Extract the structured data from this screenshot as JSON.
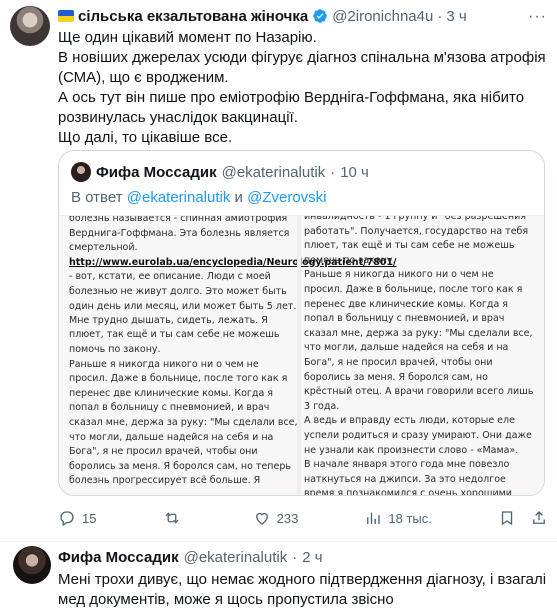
{
  "tweet": {
    "author_name": "сільська екзальтована жіночка",
    "author_handle": "@2ironichna4u",
    "dot": "·",
    "time": "3 ч",
    "more": "···",
    "lines": [
      "Ще один цікавий момент по Назарію.",
      "В новіших джерелах усюди фігурує діагноз спінальна м'язова атрофія (СМА), що є вродженим.",
      "А ось тут він пише про еміотрофію Вердніга-Гоффмана, яка нібито розвинулась унаслідок вакцинації.",
      "Що далі, то цікавіше все."
    ]
  },
  "quote": {
    "author_name": "Фифа Моссадик",
    "author_handle": "@ekaterinalutik",
    "dot": "·",
    "time": "10 ч",
    "reply_prefix": "В ответ",
    "reply_mention_1": "@ekaterinalutik",
    "reply_and": "и",
    "reply_mention_2": "@Zverovski",
    "image": {
      "left_column": [
        "болезнь называется - спинная амиотрофия Верднига-Гоффмана. Эта болезнь является смертельной.",
        "http://www.eurolab.ua/encyclopedia/Neurology.patient/7801/",
        "- вот, кстати, ее описание. Люди с моей болезнью не живут долго. Это может быть один день или месяц, или может быть 5 лет. Мне трудно дышать, сидеть, лежать. Я пытаюсь заниматься, поднимать гантели до 1 кг по крайней мере пару раз. Хоть и помогаю себе сделать самый самый...",
        "плюет, так ещё и ты сам себе не можешь помочь по закону.",
        "Раньше я никогда никого ни о чем не просил. Даже в больнице, после того как я перенес две клинические комы. Когда я попал в больницу с пневмонией, и врач сказал мне, держа за руку: \"Мы сделали все, что могли, дальше надейся на себя и на Бога\", я не просил врачей, чтобы они боролись за меня. Я боролся сам, но теперь болезнь прогрессирует всё больше. Я"
      ],
      "right_column": [
        "инвалидность - 1 группу и \"без разрешения работать\". Получается, государство на тебя плюет, так ещё и ты сам себе не можешь помочь по закону.",
        "Раньше я никогда никого ни о чем не просил. Даже в больнице, после того как я перенес две клинические комы. Когда я попал в больницу с пневмонией, и врач сказал мне, держа за руку: \"Мы сделали все, что могли, дальше надейся на себя и на Бога\", я не просил врачей, чтобы они боролись за меня. Я боролся сам, но крёстный отец. А врачи говорили всего лишь 3 года.",
        "А ведь и вправду есть люди, которые еле успели родиться и сразу умирают. Они даже не узнали как произнести слово - «Мама».",
        "В начале января этого года мне повезло наткнуться на джипси. За это недолгое время я познакомился с очень хорошими людьми. Это Лика Герасимова, Михаил Карпов, \"S.Rebavchenko\", Антон Макиевский, Таня"
      ]
    }
  },
  "actions": {
    "replies": "15",
    "retweets": "",
    "likes": "233",
    "views": "18 тыс."
  },
  "reply": {
    "author_name": "Фифа Моссадик",
    "author_handle": "@ekaterinalutik",
    "dot": "·",
    "time": "2 ч",
    "text": "Мені трохи дивує, що немає жодного підтвердження діагнозу, і взагалі мед документів, може я щось пропустила звісно"
  },
  "colors": {
    "accent": "#1d9bf0",
    "secondary_text": "#536471",
    "border": "#cfd9de"
  }
}
